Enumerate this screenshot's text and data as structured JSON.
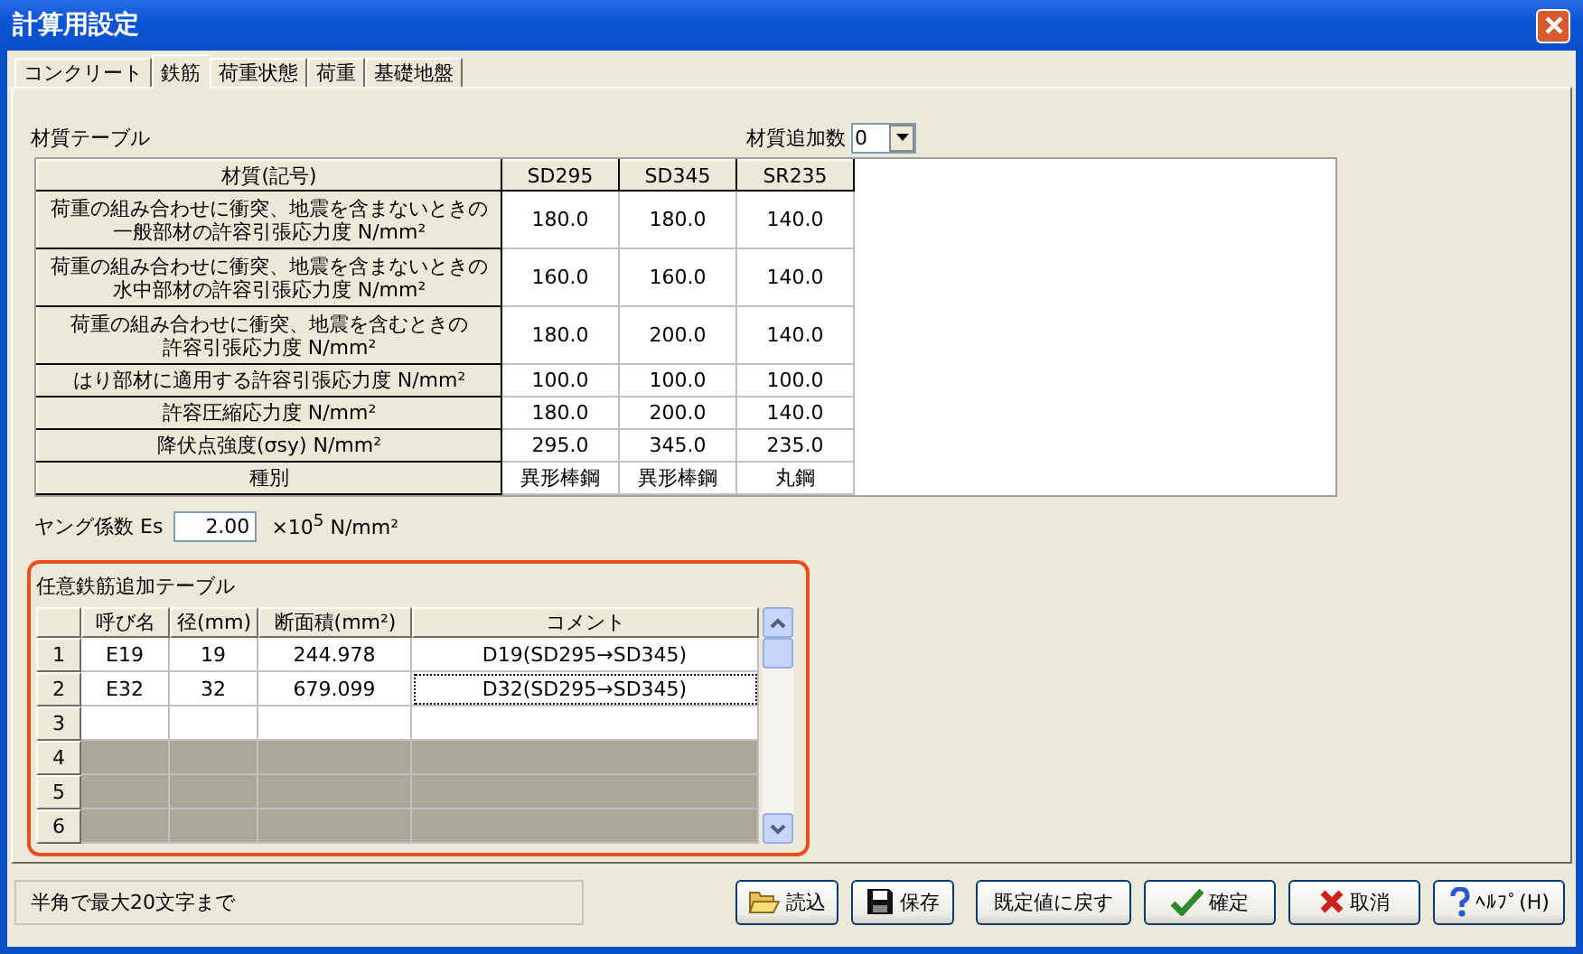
{
  "window": {
    "title": "計算用設定"
  },
  "tabs": [
    {
      "label": "コンクリート",
      "selected": false
    },
    {
      "label": "鉄筋",
      "selected": true
    },
    {
      "label": "荷重状態",
      "selected": false
    },
    {
      "label": "荷重",
      "selected": false
    },
    {
      "label": "基礎地盤",
      "selected": false
    }
  ],
  "material_table": {
    "title": "材質テーブル",
    "add_count_label": "材質追加数",
    "add_count_value": "0",
    "header": "材質(記号)",
    "columns": [
      "SD295",
      "SD345",
      "SR235"
    ],
    "rows": [
      {
        "label": [
          "荷重の組み合わせに衝突、地震を含まないときの",
          "一般部材の許容引張応力度 N/mm²"
        ],
        "values": [
          "180.0",
          "180.0",
          "140.0"
        ]
      },
      {
        "label": [
          "荷重の組み合わせに衝突、地震を含まないときの",
          "水中部材の許容引張応力度 N/mm²"
        ],
        "values": [
          "160.0",
          "160.0",
          "140.0"
        ]
      },
      {
        "label": [
          "荷重の組み合わせに衝突、地震を含むときの",
          "許容引張応力度 N/mm²"
        ],
        "values": [
          "180.0",
          "200.0",
          "140.0"
        ]
      },
      {
        "label": [
          "はり部材に適用する許容引張応力度 N/mm²"
        ],
        "values": [
          "100.0",
          "100.0",
          "100.0"
        ]
      },
      {
        "label": [
          "許容圧縮応力度 N/mm²"
        ],
        "values": [
          "180.0",
          "200.0",
          "140.0"
        ]
      },
      {
        "label": [
          "降伏点強度(σsy) N/mm²"
        ],
        "values": [
          "295.0",
          "345.0",
          "235.0"
        ]
      },
      {
        "label": [
          "種別"
        ],
        "values": [
          "異形棒鋼",
          "異形棒鋼",
          "丸鋼"
        ]
      }
    ]
  },
  "young": {
    "label": "ヤング係数 Es",
    "value": "2.00",
    "unit": "×10$^{5}$ N/mm²"
  },
  "custom_table": {
    "title": "任意鉄筋追加テーブル",
    "columns": [
      "呼び名",
      "径(mm)",
      "断面積(mm²)",
      "コメント"
    ],
    "rows": [
      {
        "number": "1",
        "cells": [
          "E19",
          "19",
          "244.978",
          "D19(SD295→SD345)"
        ],
        "disabled": false,
        "focused": false
      },
      {
        "number": "2",
        "cells": [
          "E32",
          "32",
          "679.099",
          "D32(SD295→SD345)"
        ],
        "disabled": false,
        "focused": true
      },
      {
        "number": "3",
        "cells": [],
        "disabled": false,
        "focused": false
      },
      {
        "number": "4",
        "cells": [],
        "disabled": true,
        "focused": false
      },
      {
        "number": "5",
        "cells": [],
        "disabled": true,
        "focused": false
      },
      {
        "number": "6",
        "cells": [],
        "disabled": true,
        "focused": false
      }
    ]
  },
  "status_bar": {
    "text": "半角で最大20文字まで"
  },
  "buttons": [
    {
      "label": "読込",
      "kind": "open"
    },
    {
      "label": "保存",
      "kind": "save"
    },
    {
      "label": "既定値に戻す",
      "kind": "plain"
    },
    {
      "label": "確定",
      "kind": "ok"
    },
    {
      "label": "取消",
      "kind": "cancel"
    },
    {
      "label": "ﾍﾙﾌﾟ(H)",
      "kind": "help"
    }
  ]
}
